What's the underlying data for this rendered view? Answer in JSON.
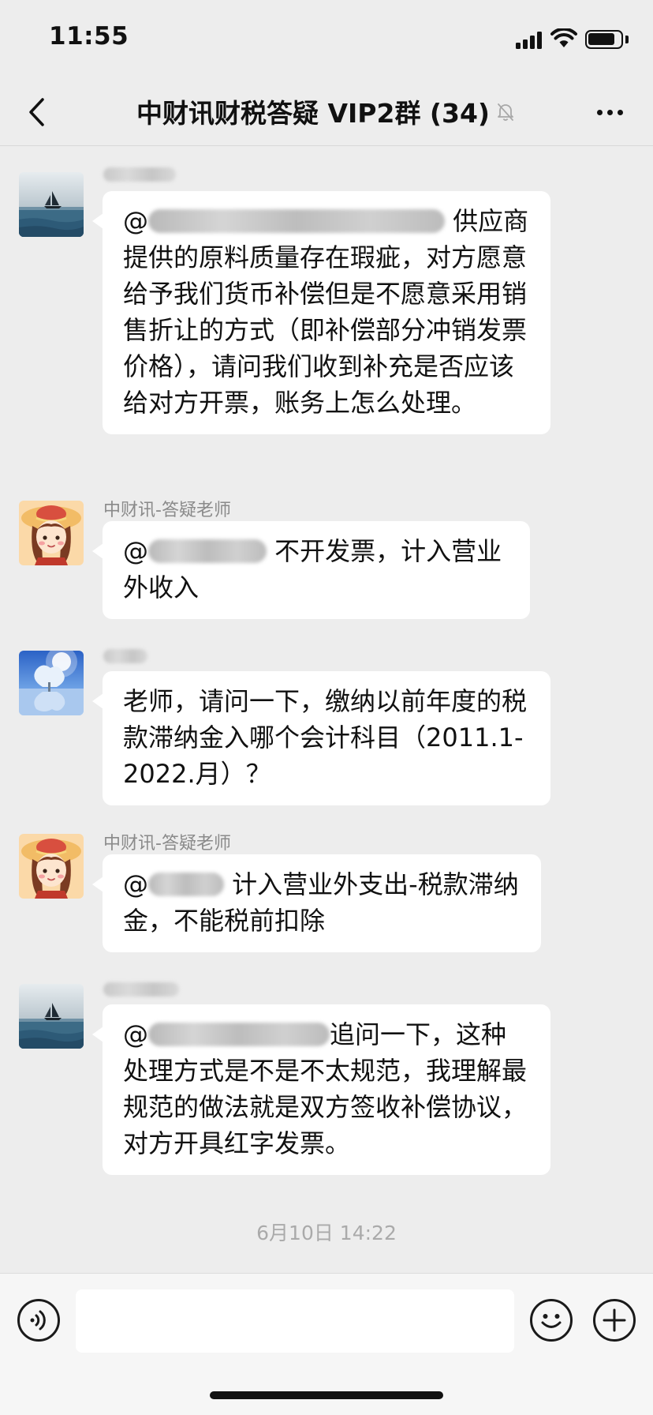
{
  "status_bar": {
    "time": "11:55"
  },
  "nav": {
    "title": "中财讯财税答疑 VIP2群 (34)"
  },
  "messages": [
    {
      "sender": "",
      "at_symbol": "@",
      "text_after_mention": " 供应商提供的原料质量存在瑕疵，对方愿意给予我们货币补偿但是不愿意采用销售折让的方式（即补偿部分冲销发票价格），请问我们收到补充是否应该给对方开票，账务上怎么处理。"
    },
    {
      "sender": "中财讯-答疑老师",
      "at_symbol": "@",
      "text_after_mention": " 不开发票，计入营业外收入"
    },
    {
      "sender": "",
      "text": "老师，请问一下，缴纳以前年度的税款滞纳金入哪个会计科目（2011.1-2022.月）？"
    },
    {
      "sender": "中财讯-答疑老师",
      "at_symbol": "@",
      "text_after_mention": " 计入营业外支出-税款滞纳金，不能税前扣除"
    },
    {
      "sender": "",
      "at_symbol": "@",
      "text_after_mention": "追问一下，这种处理方式是不是不太规范，我理解最规范的做法就是双方签收补偿协议，对方开具红字发票。"
    }
  ],
  "timestamp": "6月10日 14:22",
  "input": {
    "placeholder": ""
  },
  "colors": {
    "background": "#ededed",
    "bubble": "#ffffff",
    "sender_name": "#8a8a8a",
    "timestamp": "#aaaaaa"
  },
  "icons": [
    "back-chevron-icon",
    "mute-bell-icon",
    "more-icon",
    "voice-icon",
    "emoji-icon",
    "plus-icon"
  ]
}
